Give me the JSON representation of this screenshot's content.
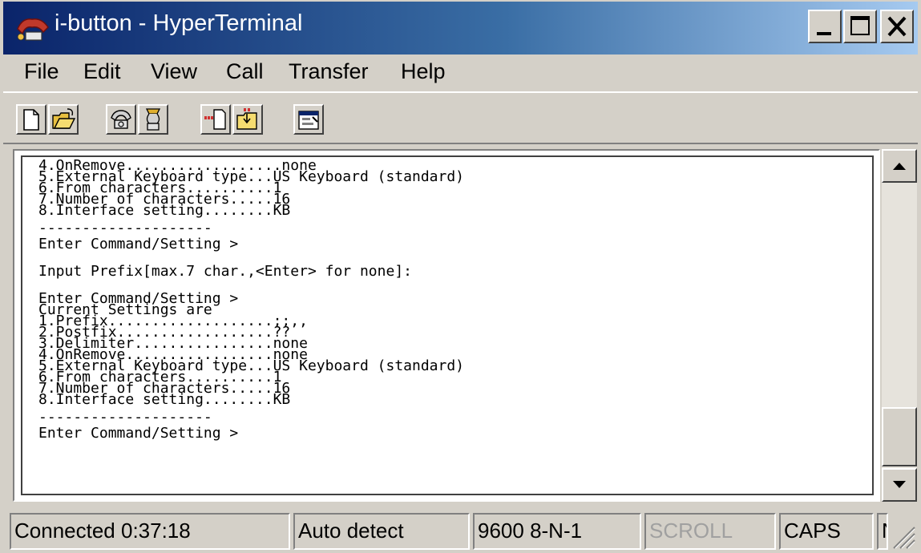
{
  "window": {
    "title": "i-button - HyperTerminal",
    "app_icon": "hyperterminal-phone-icon",
    "caption_buttons": [
      "minimize-icon",
      "maximize-icon",
      "close-icon"
    ]
  },
  "menu": {
    "items": [
      "File",
      "Edit",
      "View",
      "Call",
      "Transfer",
      "Help"
    ]
  },
  "toolbar": {
    "buttons": [
      "new-document-icon",
      "open-folder-icon",
      "connect-phone-icon",
      "disconnect-phone-icon",
      "send-file-icon",
      "receive-file-icon",
      "properties-icon"
    ]
  },
  "terminal": {
    "lines": [
      "4.OnRemove..................none",
      "5.External Keyboard type...US Keyboard (standard)",
      "6.From characters..........1",
      "7.Number of characters.....16",
      "8.Interface setting........KB",
      "--------------------",
      "Enter Command/Setting >",
      "Input Prefix[max.7 char.,<Enter> for none]:",
      "Enter Command/Setting >",
      "Current Settings are",
      "1.Prefix...................;;,,",
      "2.Postfix..................??",
      "3.Delimiter................none",
      "4.OnRemove.................none",
      "5.External Keyboard type...US Keyboard (standard)",
      "6.From characters..........1",
      "7.Number of characters.....16",
      "8.Interface setting........KB",
      "--------------------",
      "Enter Command/Setting >"
    ]
  },
  "scrollbar": {
    "position_fraction": 0.95
  },
  "status": {
    "connection": "Connected 0:37:18",
    "detect": "Auto detect",
    "port_settings": "9600 8-N-1",
    "scroll": "SCROLL",
    "caps": "CAPS",
    "num": "NUM"
  }
}
